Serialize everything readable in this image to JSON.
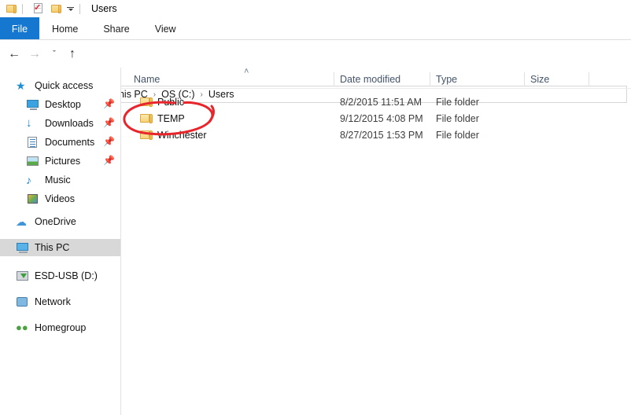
{
  "window": {
    "title": "Users",
    "quick_access_toolbar": [
      {
        "name": "explorer-icon",
        "icon": "folder"
      },
      {
        "name": "properties-icon",
        "icon": "document-check"
      },
      {
        "name": "new-folder-icon",
        "icon": "folder"
      },
      {
        "name": "customize-icon",
        "icon": "caret-down"
      }
    ]
  },
  "ribbon": {
    "tabs": [
      {
        "label": "File",
        "active": true
      },
      {
        "label": "Home",
        "active": false
      },
      {
        "label": "Share",
        "active": false
      },
      {
        "label": "View",
        "active": false
      }
    ],
    "file_tab_color": "#1577d0"
  },
  "navigation": {
    "back_icon": "←",
    "forward_icon": "→",
    "recent_icon": "ˇ",
    "up_icon": "↑",
    "breadcrumbs": [
      "This PC",
      "OS (C:)",
      "Users"
    ],
    "separator": "›"
  },
  "sidebar": {
    "items": [
      {
        "label": "Quick access",
        "icon": "star-icon",
        "indent": 0,
        "pinned": false,
        "selected": false
      },
      {
        "label": "Desktop",
        "icon": "monitor-icon",
        "indent": 1,
        "pinned": true,
        "selected": false
      },
      {
        "label": "Downloads",
        "icon": "download-arrow-icon",
        "indent": 1,
        "pinned": true,
        "selected": false
      },
      {
        "label": "Documents",
        "icon": "document-icon",
        "indent": 1,
        "pinned": true,
        "selected": false
      },
      {
        "label": "Pictures",
        "icon": "picture-icon",
        "indent": 1,
        "pinned": true,
        "selected": false
      },
      {
        "label": "Music",
        "icon": "music-note-icon",
        "indent": 1,
        "pinned": false,
        "selected": false
      },
      {
        "label": "Videos",
        "icon": "video-icon",
        "indent": 1,
        "pinned": false,
        "selected": false
      },
      {
        "label": "OneDrive",
        "icon": "cloud-icon",
        "indent": 0,
        "pinned": false,
        "selected": false
      },
      {
        "label": "This PC",
        "icon": "computer-icon",
        "indent": 0,
        "pinned": false,
        "selected": true
      },
      {
        "label": "ESD-USB (D:)",
        "icon": "usb-drive-icon",
        "indent": 0,
        "pinned": false,
        "selected": false
      },
      {
        "label": "Network",
        "icon": "network-icon",
        "indent": 0,
        "pinned": false,
        "selected": false
      },
      {
        "label": "Homegroup",
        "icon": "homegroup-icon",
        "indent": 0,
        "pinned": false,
        "selected": false
      }
    ],
    "selected_background": "#d8d8d8",
    "pin_icon": "📌"
  },
  "filelist": {
    "columns": [
      {
        "label": "Name",
        "sorted": "ascending",
        "sort_indicator": "˄"
      },
      {
        "label": "Date modified",
        "sorted": null,
        "sort_indicator": ""
      },
      {
        "label": "Type",
        "sorted": null,
        "sort_indicator": ""
      },
      {
        "label": "Size",
        "sorted": null,
        "sort_indicator": ""
      }
    ],
    "header_color": "#44546a",
    "rows": [
      {
        "name": "Public",
        "date_modified": "8/2/2015 11:51 AM",
        "type": "File folder",
        "size": ""
      },
      {
        "name": "TEMP",
        "date_modified": "9/12/2015 4:08 PM",
        "type": "File folder",
        "size": ""
      },
      {
        "name": "Winchester",
        "date_modified": "8/27/2015 1:53 PM",
        "type": "File folder",
        "size": ""
      }
    ]
  },
  "annotation": {
    "type": "hand-drawn-ellipse",
    "color": "#e8252a",
    "targets": "TEMP",
    "stroke_width": 3
  }
}
